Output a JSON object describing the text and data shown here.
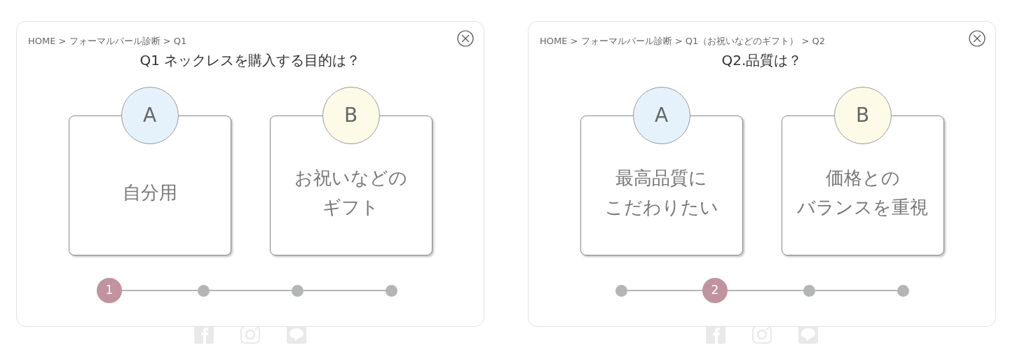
{
  "panels": [
    {
      "breadcrumb": "HOME > フォーマルパール診断 > Q1",
      "question": "Q1 ネックレスを購入する目的は？",
      "options": [
        {
          "letter": "A",
          "color": "#e6f2fb",
          "lines": [
            "自分用"
          ]
        },
        {
          "letter": "B",
          "color": "#fdfbe8",
          "lines": [
            "お祝いなどの",
            "ギフト"
          ]
        }
      ],
      "steps": [
        {
          "label": "1",
          "selected": true
        },
        {
          "selected": false
        },
        {
          "selected": false
        },
        {
          "selected": false
        }
      ]
    },
    {
      "breadcrumb": "HOME > フォーマルパール診断 > Q1（お祝いなどのギフト） > Q2",
      "question": "Q2.品質は？",
      "options": [
        {
          "letter": "A",
          "color": "#e6f2fb",
          "lines": [
            "最高品質に",
            "こだわりたい"
          ]
        },
        {
          "letter": "B",
          "color": "#fdfbe8",
          "lines": [
            "価格との",
            "バランスを重視"
          ]
        }
      ],
      "steps": [
        {
          "selected": false
        },
        {
          "label": "2",
          "selected": true
        },
        {
          "selected": false
        },
        {
          "selected": false
        }
      ]
    }
  ]
}
